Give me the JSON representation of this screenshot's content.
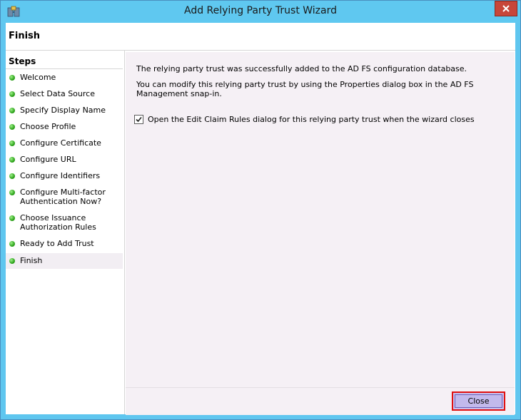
{
  "window": {
    "title": "Add Relying Party Trust Wizard"
  },
  "header": {
    "title": "Finish"
  },
  "steps": {
    "heading": "Steps",
    "items": [
      {
        "label": "Welcome"
      },
      {
        "label": "Select Data Source"
      },
      {
        "label": "Specify Display Name"
      },
      {
        "label": "Choose Profile"
      },
      {
        "label": "Configure Certificate"
      },
      {
        "label": "Configure URL"
      },
      {
        "label": "Configure Identifiers"
      },
      {
        "label_line1": "Configure Multi-factor",
        "label_line2": "Authentication Now?"
      },
      {
        "label_line1": "Choose Issuance",
        "label_line2": "Authorization Rules"
      },
      {
        "label": "Ready to Add Trust"
      },
      {
        "label": "Finish"
      }
    ],
    "selected": "Finish"
  },
  "main": {
    "message1": "The relying party trust was successfully added to the AD FS configuration database.",
    "message2": "You can modify this relying party trust by using the Properties dialog box in the AD FS Management snap-in.",
    "checkbox_label": "Open the Edit Claim Rules dialog for this relying party trust when the wizard closes",
    "checkbox_checked": true
  },
  "footer": {
    "close_label": "Close"
  },
  "colors": {
    "titlebar": "#5fc8f0",
    "accent_highlight": "#e01010",
    "step_done": "#2ea51c"
  }
}
